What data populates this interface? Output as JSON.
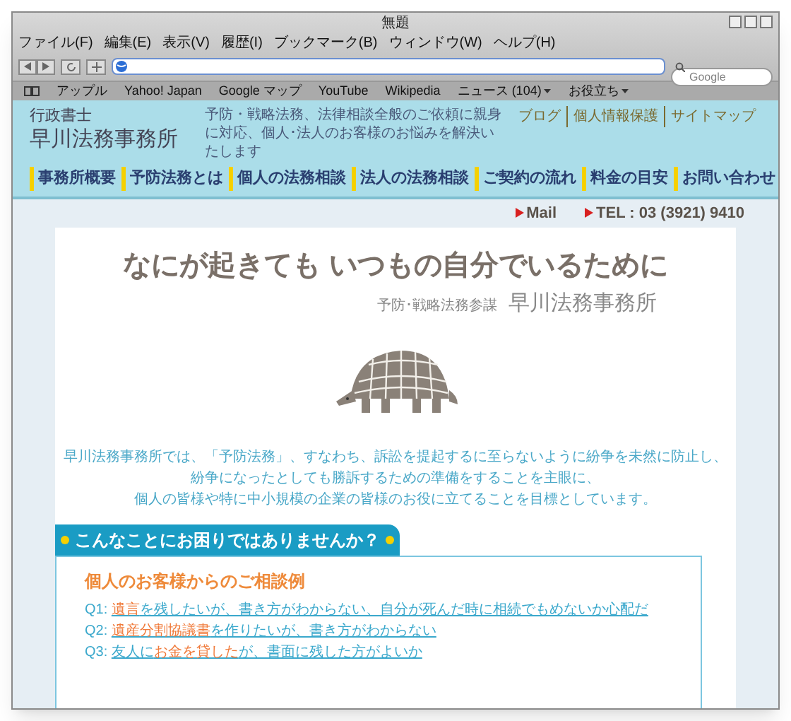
{
  "window": {
    "title": "無題"
  },
  "menu": [
    "ファイル(F)",
    "編集(E)",
    "表示(V)",
    "履歴(I)",
    "ブックマーク(B)",
    "ウィンドウ(W)",
    "ヘルプ(H)"
  ],
  "search": {
    "placeholder": "Google"
  },
  "bookmarks": [
    {
      "label": "アップル",
      "menu": false
    },
    {
      "label": "Yahoo! Japan",
      "menu": false
    },
    {
      "label": "Google マップ",
      "menu": false
    },
    {
      "label": "YouTube",
      "menu": false
    },
    {
      "label": "Wikipedia",
      "menu": false
    },
    {
      "label": "ニュース (104)",
      "menu": true
    },
    {
      "label": "お役立ち",
      "menu": true
    }
  ],
  "site": {
    "logo_small": "行政書士",
    "logo": "早川法務事務所",
    "tagline": "予防・戦略法務、法律相談全般のご依頼に親身に対応、個人･法人のお客様のお悩みを解決いたします",
    "links": [
      "ブログ",
      "個人情報保護",
      "サイトマップ"
    ],
    "nav": [
      "事務所概要",
      "予防法務とは",
      "個人の法務相談",
      "法人の法務相談",
      "ご契約の流れ",
      "料金の目安",
      "お問い合わせ"
    ],
    "contact": [
      {
        "label": "Mail"
      },
      {
        "label": "TEL : 03 (3921) 9410"
      }
    ]
  },
  "hero": {
    "headline": "なにが起きても いつもの自分でいるために",
    "sub_label": "予防･戦略法務参謀",
    "sub_name": "早川法務事務所"
  },
  "intro": [
    "早川法務事務所では、「予防法務」、すなわち、訴訟を提起するに至らないように紛争を未然に防止し、",
    "紛争になったとしても勝訴するための準備をすることを主眼に、",
    "個人の皆様や特に中小規模の企業の皆様のお役に立てることを目標としています。"
  ],
  "trouble": {
    "heading": "こんなことにお困りではありませんか？",
    "section_title": "個人のお客様からのご相談例",
    "questions": [
      {
        "number": "Q1:",
        "parts": [
          {
            "text": "遺言",
            "kind": "highlight"
          },
          {
            "text": "を残したいが、書き方がわからない、自分が死んだ時に相続でもめないか心配だ",
            "kind": "plain"
          }
        ]
      },
      {
        "number": "Q2:",
        "parts": [
          {
            "text": "遺産分割協議書",
            "kind": "highlight"
          },
          {
            "text": "を作りたいが、書き方がわからない",
            "kind": "plain"
          }
        ]
      },
      {
        "number": "Q3:",
        "parts": [
          {
            "text": "友人に",
            "kind": "plain"
          },
          {
            "text": "お金を貸した",
            "kind": "highlight"
          },
          {
            "text": "が、書面に残した方がよいか",
            "kind": "plain"
          }
        ]
      }
    ]
  }
}
